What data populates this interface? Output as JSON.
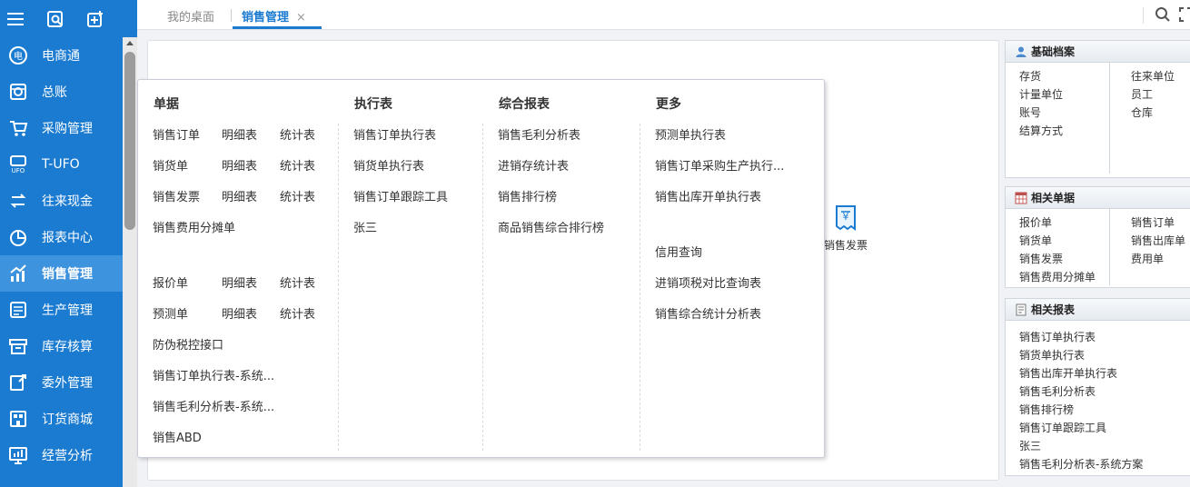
{
  "sidebar": {
    "top_icons": [
      "menu-icon",
      "search-doc-icon",
      "add-icon"
    ],
    "items": [
      {
        "label": "电商通",
        "icon": "ecommerce-icon"
      },
      {
        "label": "总账",
        "icon": "ledger-icon"
      },
      {
        "label": "采购管理",
        "icon": "purchase-icon"
      },
      {
        "label": "T-UFO",
        "icon": "ufo-icon"
      },
      {
        "label": "往来现金",
        "icon": "cash-icon"
      },
      {
        "label": "报表中心",
        "icon": "report-icon"
      },
      {
        "label": "销售管理",
        "icon": "sales-icon"
      },
      {
        "label": "生产管理",
        "icon": "production-icon"
      },
      {
        "label": "库存核算",
        "icon": "inventory-icon"
      },
      {
        "label": "委外管理",
        "icon": "outsourcing-icon"
      },
      {
        "label": "订货商城",
        "icon": "mall-icon"
      },
      {
        "label": "经营分析",
        "icon": "analysis-icon"
      }
    ],
    "active": "销售管理"
  },
  "tabs": {
    "desktop": "我的桌面",
    "sales": "销售管理",
    "close": "×"
  },
  "shortcut": {
    "invoice_label": "销售发票"
  },
  "menu": {
    "documents": {
      "title": "单据",
      "sales_order": "销售订单",
      "delivery_note": "销货单",
      "sales_invoice": "销售发票",
      "expense_allocation": "销售费用分摊单",
      "quotation": "报价单",
      "forecast": "预测单",
      "anti_counterfeit": "防伪税控接口",
      "order_exec_sys": "销售订单执行表-系统...",
      "margin_sys": "销售毛利分析表-系统...",
      "sales_abd": "销售ABD",
      "detail": "明细表",
      "stats": "统计表"
    },
    "execution": {
      "title": "执行表",
      "order_exec": "销售订单执行表",
      "delivery_exec": "销货单执行表",
      "order_tracking": "销售订单跟踪工具",
      "zhangsan": "张三"
    },
    "reports": {
      "title": "综合报表",
      "gross_margin": "销售毛利分析表",
      "psi_stats": "进销存统计表",
      "ranking": "销售排行榜",
      "product_ranking": "商品销售综合排行榜"
    },
    "more": {
      "title": "更多",
      "forecast_exec": "预测单执行表",
      "order_purchase_prod": "销售订单采购生产执行...",
      "outbound_invoice": "销售出库开单执行表",
      "credit_query": "信用查询",
      "tax_compare": "进销项税对比查询表",
      "sales_analysis": "销售综合统计分析表"
    }
  },
  "right_panels": {
    "basic": {
      "title": "基础档案",
      "left": [
        "存货",
        "计量单位",
        "账号",
        "结算方式"
      ],
      "right": [
        "往来单位",
        "员工",
        "仓库"
      ]
    },
    "docs": {
      "title": "相关单据",
      "left": [
        "报价单",
        "销货单",
        "销售发票",
        "销售费用分摊单"
      ],
      "right": [
        "销售订单",
        "销售出库单",
        "费用单"
      ]
    },
    "reports": {
      "title": "相关报表",
      "items": [
        "销售订单执行表",
        "销货单执行表",
        "销售出库开单执行表",
        "销售毛利分析表",
        "销售排行榜",
        "销售订单跟踪工具",
        "张三",
        "销售毛利分析表-系统方案"
      ]
    }
  }
}
